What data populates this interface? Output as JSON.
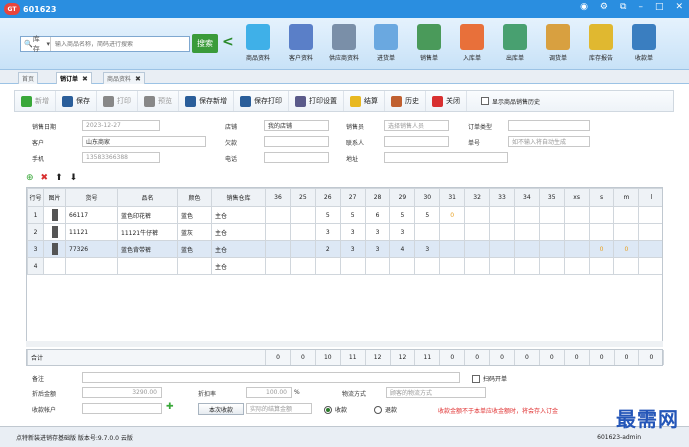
{
  "app": {
    "title": "601623",
    "logo": "GT"
  },
  "window": {
    "min": "–",
    "max": "□",
    "close": "✕",
    "icons": [
      "◉",
      "⚙",
      "⧉"
    ]
  },
  "search": {
    "scope": "库存",
    "placeholder": "输入商品名称，简码进行搜索",
    "button": "搜索"
  },
  "nav": [
    {
      "label": "商品资料",
      "color": "#3fb0e8"
    },
    {
      "label": "客户资料",
      "color": "#5a7fc8"
    },
    {
      "label": "供应商资料",
      "color": "#7a8fa8"
    },
    {
      "label": "进货单",
      "color": "#6aa8e0"
    },
    {
      "label": "销售单",
      "color": "#4a9a5a"
    },
    {
      "label": "入库单",
      "color": "#e8703a"
    },
    {
      "label": "出库单",
      "color": "#48a070"
    },
    {
      "label": "调货单",
      "color": "#d8a040"
    },
    {
      "label": "库存报告",
      "color": "#e0b830"
    },
    {
      "label": "收款单",
      "color": "#3a7ec0"
    }
  ],
  "tabs": [
    {
      "label": "首页"
    },
    {
      "label": "销订单"
    },
    {
      "label": "商品资料"
    }
  ],
  "toolbar": [
    {
      "label": "新增",
      "color": "#3aa83a",
      "disabled": true
    },
    {
      "label": "保存",
      "color": "#2a5e9a",
      "disabled": false
    },
    {
      "label": "打印",
      "color": "#888888",
      "disabled": true
    },
    {
      "label": "预览",
      "color": "#888888",
      "disabled": true
    },
    {
      "label": "保存新增",
      "color": "#2a5e9a",
      "disabled": false
    },
    {
      "label": "保存打印",
      "color": "#2a5e9a",
      "disabled": false
    },
    {
      "label": "打印设置",
      "color": "#5a5a8a",
      "disabled": false
    },
    {
      "label": "结算",
      "color": "#e8b820",
      "disabled": false
    },
    {
      "label": "历史",
      "color": "#c06030",
      "disabled": false
    },
    {
      "label": "关闭",
      "color": "#d83030",
      "disabled": false
    }
  ],
  "show_history": "显示商品销售历史",
  "form": {
    "date_label": "销售日期",
    "date": "2023-12-27",
    "customer_label": "客户",
    "customer": "山东商家",
    "phone_label": "手机",
    "phone": "13583366388",
    "store_label": "店铺",
    "store": "我的店铺",
    "debt_label": "欠款",
    "tel_label": "电话",
    "clerk_label": "销售员",
    "clerk_ph": "选择销售人员",
    "contact_label": "联系人",
    "address_label": "地址",
    "ordertype_label": "订单类型",
    "orderno_label": "单号",
    "orderno_ph": "如不输入将自动生成"
  },
  "grid_tools": [
    "⊕",
    "✖",
    "⬆",
    "⬇"
  ],
  "grid": {
    "headers": [
      "行号",
      "图片",
      "货号",
      "品名",
      "颜色",
      "销售仓库",
      "36",
      "25",
      "26",
      "27",
      "28",
      "29",
      "30",
      "31",
      "32",
      "33",
      "34",
      "35",
      "xs",
      "s",
      "m",
      "l"
    ],
    "rows": [
      {
        "no": "1",
        "code": "66117",
        "name": "蓝色印花裤",
        "color": "蓝色",
        "wh": "主仓",
        "sizes": [
          "",
          "",
          "5",
          "5",
          "6",
          "5",
          "5",
          "0",
          "",
          "",
          "",
          "",
          "",
          "",
          "",
          ""
        ]
      },
      {
        "no": "2",
        "code": "11121",
        "name": "11121牛仔裤",
        "color": "蓝灰",
        "wh": "主仓",
        "sizes": [
          "",
          "",
          "3",
          "3",
          "3",
          "3",
          "",
          "",
          "",
          "",
          "",
          "",
          "",
          "",
          "",
          ""
        ]
      },
      {
        "no": "3",
        "code": "77326",
        "name": "蓝色背带裤",
        "color": "蓝色",
        "wh": "主仓",
        "sizes": [
          "",
          "",
          "2",
          "3",
          "3",
          "4",
          "3",
          "",
          "",
          "",
          "",
          "",
          "",
          "0",
          "0",
          ""
        ]
      },
      {
        "no": "4",
        "code": "",
        "name": "",
        "color": "",
        "wh": "主仓",
        "sizes": [
          "",
          "",
          "",
          "",
          "",
          "",
          "",
          "",
          "",
          "",
          "",
          "",
          "",
          "",
          "",
          ""
        ]
      }
    ]
  },
  "totals": {
    "label": "合计",
    "values": [
      "0",
      "0",
      "10",
      "11",
      "12",
      "12",
      "11",
      "0",
      "0",
      "0",
      "0",
      "0",
      "0",
      "0",
      "0",
      "0"
    ]
  },
  "bottom": {
    "remark_label": "备注",
    "return_label": "扫码开单",
    "amount_label": "折后金额",
    "amount": "3290.00",
    "discount_label": "折扣率",
    "discount": "100.00",
    "pct": "%",
    "logistics_label": "物流方式",
    "logistics_ph": "顾客的物流方式",
    "account_label": "收款帐户",
    "pay_btn": "本次收款",
    "pay_ph": "实际的结算金额",
    "recv": "收款",
    "refund": "退款",
    "warning": "收款金额不于本单应收金额时，将会存入订金"
  },
  "status": {
    "left": "点特新装进销存基础版  版本号:9.7.0.0 云版",
    "right": "601623-admin"
  },
  "watermark": "最需网"
}
